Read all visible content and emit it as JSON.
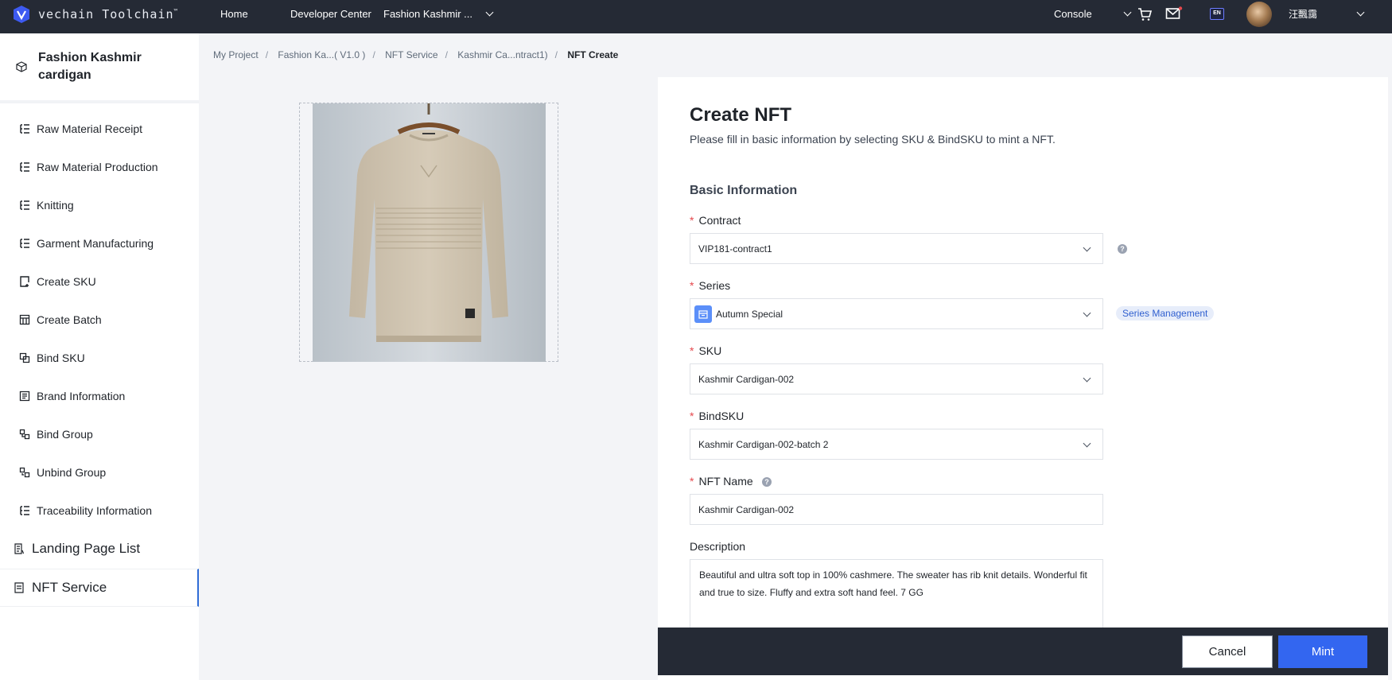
{
  "topbar": {
    "logo_text": "vechain Toolchain",
    "logo_tm": "™",
    "nav": {
      "home": "Home",
      "developer_center": "Developer Center",
      "project": "Fashion Kashmir ...",
      "console": "Console"
    },
    "lang": "EN",
    "user_name": "汪飄靄"
  },
  "sidebar": {
    "project_title": "Fashion Kashmir cardigan",
    "items": [
      {
        "label": "Raw Material Receipt"
      },
      {
        "label": "Raw Material Production"
      },
      {
        "label": "Knitting"
      },
      {
        "label": "Garment Manufacturing"
      },
      {
        "label": "Create SKU"
      },
      {
        "label": "Create Batch"
      },
      {
        "label": "Bind SKU"
      },
      {
        "label": "Brand Information"
      },
      {
        "label": "Bind Group"
      },
      {
        "label": "Unbind Group"
      },
      {
        "label": "Traceability Information"
      }
    ],
    "sections": [
      {
        "label": "Landing Page List"
      },
      {
        "label": "NFT Service"
      }
    ]
  },
  "breadcrumb": {
    "items": [
      "My Project",
      "Fashion Ka...( V1.0 )",
      "NFT Service",
      "Kashmir Ca...ntract1)"
    ],
    "current": "NFT Create",
    "separator": "/"
  },
  "form": {
    "title": "Create NFT",
    "subtitle": "Please fill in basic information by selecting SKU & BindSKU to mint a NFT.",
    "section_title": "Basic Information",
    "required_mark": "*",
    "help_mark": "?",
    "contract": {
      "label": "Contract",
      "value": "VIP181-contract1"
    },
    "series": {
      "label": "Series",
      "value": "Autumn Special",
      "manage_label": "Series Management"
    },
    "sku": {
      "label": "SKU",
      "value": "Kashmir Cardigan-002"
    },
    "bindsku": {
      "label": "BindSKU",
      "value": "Kashmir Cardigan-002-batch 2"
    },
    "nft_name": {
      "label": "NFT Name",
      "value": "Kashmir Cardigan-002"
    },
    "description": {
      "label": "Description",
      "value": "Beautiful and ultra soft top in 100% cashmere. The sweater has rib knit details. Wonderful fit and true to size. Fluffy and extra soft hand feel. 7 GG"
    }
  },
  "footer": {
    "cancel_label": "Cancel",
    "mint_label": "Mint"
  },
  "colors": {
    "topbar_bg": "#252a35",
    "accent": "#3366f0",
    "active_border": "#2f6cd6",
    "required": "#e5484d"
  }
}
